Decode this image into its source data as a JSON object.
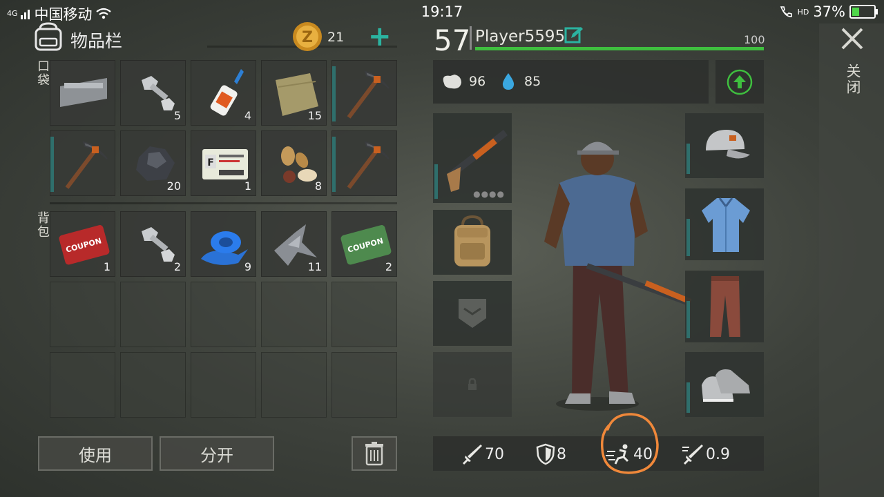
{
  "status_bar": {
    "carrier": "中国移动",
    "network": "4G",
    "time": "19:17",
    "battery": "37%",
    "hd": "HD",
    "battery_level": 0.37
  },
  "inventory": {
    "title": "物品栏",
    "coins": "21",
    "add_label": "+",
    "pocket_label": "口袋",
    "backpack_label": "背包",
    "pocket_slots": [
      {
        "item": "electronic-part",
        "count": ""
      },
      {
        "item": "bolt-and-nut",
        "count": "5"
      },
      {
        "item": "super-glue",
        "count": "4"
      },
      {
        "item": "cloth",
        "count": "15"
      },
      {
        "item": "pickaxe",
        "count": ""
      },
      {
        "item": "pickaxe",
        "count": ""
      },
      {
        "item": "ore",
        "count": "20"
      },
      {
        "item": "us-army-id-card",
        "count": "1"
      },
      {
        "item": "seeds",
        "count": "8"
      },
      {
        "item": "pickaxe",
        "count": ""
      }
    ],
    "backpack_slots": [
      {
        "item": "combat-gear-coupon",
        "count": "1"
      },
      {
        "item": "bolt-and-nut",
        "count": "2"
      },
      {
        "item": "blue-tape",
        "count": "9"
      },
      {
        "item": "scrap-metal",
        "count": "11"
      },
      {
        "item": "ration-coupon",
        "count": "2"
      }
    ],
    "use_label": "使用",
    "split_label": "分开"
  },
  "player": {
    "level": "57",
    "name": "Player5595",
    "hp_max": "100",
    "hp_fraction": 1.0,
    "hunger": "96",
    "thirst": "85"
  },
  "stats": {
    "attack": "70",
    "defense": "8",
    "speed": "40",
    "attack_speed": "0.9"
  },
  "close_label": "关闭",
  "colors": {
    "accent": "#2bb3a0",
    "hp_bar": "#3fbf3f",
    "coin": "#e0a832",
    "highlight_circle": "#f0883a"
  }
}
